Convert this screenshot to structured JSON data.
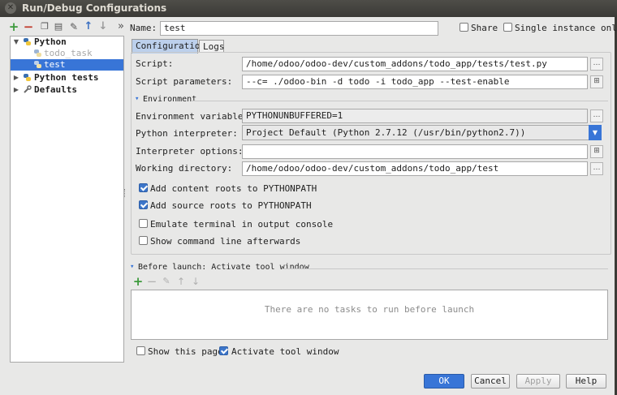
{
  "window": {
    "title": "Run/Debug Configurations",
    "close_glyph": "✕"
  },
  "toolbar": {
    "icons": [
      {
        "name": "add-icon",
        "glyph": "+",
        "color": "#3c9a3c"
      },
      {
        "name": "remove-icon",
        "glyph": "−",
        "color": "#c03a2b"
      },
      {
        "name": "copy-icon",
        "glyph": "❐",
        "color": "#555555"
      },
      {
        "name": "save-icon",
        "glyph": "▤",
        "color": "#555555"
      },
      {
        "name": "edit-defaults-icon",
        "glyph": "✎",
        "color": "#555555"
      },
      {
        "name": "move-up-icon",
        "glyph": "↑",
        "color": "#3a6fc1"
      },
      {
        "name": "move-down-icon",
        "glyph": "↓",
        "color": "#9a9a9a"
      },
      {
        "name": "more-icon",
        "glyph": "»",
        "color": "#555555"
      }
    ]
  },
  "tree": {
    "items": [
      {
        "label": "Python",
        "level": 0,
        "expanded": true,
        "bold": true
      },
      {
        "label": "todo_task",
        "level": 1,
        "muted": true
      },
      {
        "label": "test",
        "level": 1,
        "selected": true
      },
      {
        "label": "Python tests",
        "level": 0,
        "expanded": false,
        "bold": true
      },
      {
        "label": "Defaults",
        "level": 0,
        "expanded": false,
        "bold": true
      }
    ]
  },
  "name_row": {
    "label": "Name:",
    "value": "test",
    "share_label": "Share",
    "share_checked": false,
    "single_label": "Single instance only",
    "single_checked": false
  },
  "tabs": [
    {
      "label": "Configuration",
      "active": true
    },
    {
      "label": "Logs",
      "active": false
    }
  ],
  "config": {
    "script_label": "Script:",
    "script_value": "/home/odoo/odoo-dev/custom_addons/todo_app/tests/test.py",
    "params_label": "Script parameters:",
    "params_value": "--c= ./odoo-bin -d todo -i todo_app --test-enable",
    "environment_header": "Environment",
    "env_vars_label": "Environment variables:",
    "env_vars_value": "PYTHONUNBUFFERED=1",
    "interpreter_label": "Python interpreter:",
    "interpreter_value": "Project Default (Python 2.7.12 (/usr/bin/python2.7))",
    "interp_options_label": "Interpreter options:",
    "interp_options_value": "",
    "workdir_label": "Working directory:",
    "workdir_value": "/home/odoo/odoo-dev/custom_addons/todo_app/test",
    "checkboxes": [
      {
        "label": "Add content roots to PYTHONPATH",
        "checked": true
      },
      {
        "label": "Add source roots to PYTHONPATH",
        "checked": true
      },
      {
        "label": "Emulate terminal in output console",
        "checked": false
      },
      {
        "label": "Show command line afterwards",
        "checked": false
      }
    ]
  },
  "before_launch": {
    "header": "Before launch: Activate tool window",
    "empty_text": "There are no tasks to run before launch",
    "show_page_label": "Show this page",
    "show_page_checked": false,
    "activate_label": "Activate tool window",
    "activate_checked": true
  },
  "buttons": {
    "ok": "OK",
    "cancel": "Cancel",
    "apply": "Apply",
    "help": "Help"
  },
  "colors": {
    "accent": "#3875d7",
    "check": "#3d76c9"
  }
}
